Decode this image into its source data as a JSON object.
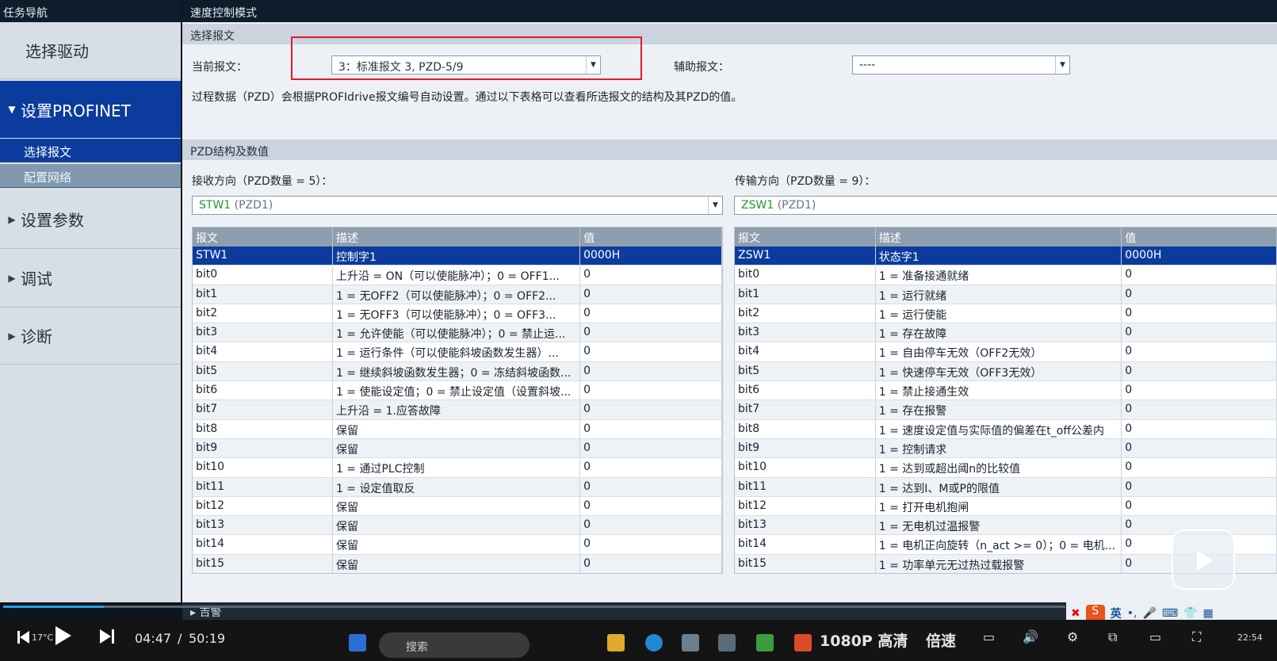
{
  "sidebar": {
    "header": "任务导航",
    "items": [
      {
        "label": "选择驱动",
        "caret": ""
      },
      {
        "label": "设置PROFINET",
        "caret": "▼"
      },
      {
        "label": "设置参数",
        "caret": "▶"
      },
      {
        "label": "调试",
        "caret": "▶"
      },
      {
        "label": "诊断",
        "caret": "▶"
      }
    ],
    "subitems": [
      "选择报文",
      "配置网络"
    ]
  },
  "header": {
    "mode_title": "速度控制模式"
  },
  "select_telegram": {
    "section_title": "选择报文",
    "current_label": "当前报文：",
    "current_value": "3：标准报文 3, PZD-5/9",
    "aux_label": "辅助报文：",
    "aux_value": "----",
    "description": "过程数据（PZD）会根据PROFIdrive报文编号自动设置。通过以下表格可以查看所选报文的结构及其PZD的值。"
  },
  "pzd": {
    "section_title": "PZD结构及数值",
    "receive": {
      "label": "接收方向（PZD数量 = 5）：",
      "select_code": "STW1",
      "select_sub": "(PZD1)",
      "headers": [
        "报文",
        "描述",
        "值"
      ],
      "rows": [
        [
          "STW1",
          "控制字1",
          "0000H"
        ],
        [
          "bit0",
          "上升沿 = ON（可以使能脉冲）；0 = OFF1...",
          "0"
        ],
        [
          "bit1",
          "1 = 无OFF2（可以使能脉冲）；0 = OFF2...",
          "0"
        ],
        [
          "bit2",
          "1 = 无OFF3（可以使能脉冲）；0 = OFF3...",
          "0"
        ],
        [
          "bit3",
          "1 = 允许使能（可以使能脉冲）；0 = 禁止运...",
          "0"
        ],
        [
          "bit4",
          "1 = 运行条件（可以使能斜坡函数发生器）...",
          "0"
        ],
        [
          "bit5",
          "1 = 继续斜坡函数发生器；0 = 冻结斜坡函数...",
          "0"
        ],
        [
          "bit6",
          "1 = 使能设定值；0 = 禁止设定值（设置斜坡...",
          "0"
        ],
        [
          "bit7",
          "上升沿 = 1.应答故障",
          "0"
        ],
        [
          "bit8",
          "保留",
          "0"
        ],
        [
          "bit9",
          "保留",
          "0"
        ],
        [
          "bit10",
          "1 = 通过PLC控制",
          "0"
        ],
        [
          "bit11",
          "1 = 设定值取反",
          "0"
        ],
        [
          "bit12",
          "保留",
          "0"
        ],
        [
          "bit13",
          "保留",
          "0"
        ],
        [
          "bit14",
          "保留",
          "0"
        ],
        [
          "bit15",
          "保留",
          "0"
        ]
      ]
    },
    "transmit": {
      "label": "传输方向（PZD数量 = 9）：",
      "select_code": "ZSW1",
      "select_sub": "(PZD1)",
      "headers": [
        "报文",
        "描述",
        "值"
      ],
      "rows": [
        [
          "ZSW1",
          "状态字1",
          "0000H"
        ],
        [
          "bit0",
          "1 = 准备接通就绪",
          "0"
        ],
        [
          "bit1",
          "1 = 运行就绪",
          "0"
        ],
        [
          "bit2",
          "1 = 运行使能",
          "0"
        ],
        [
          "bit3",
          "1 = 存在故障",
          "0"
        ],
        [
          "bit4",
          "1 = 自由停车无效（OFF2无效）",
          "0"
        ],
        [
          "bit5",
          "1 = 快速停车无效（OFF3无效）",
          "0"
        ],
        [
          "bit6",
          "1 = 禁止接通生效",
          "0"
        ],
        [
          "bit7",
          "1 = 存在报警",
          "0"
        ],
        [
          "bit8",
          "1 = 速度设定值与实际值的偏差在t_off公差内",
          "0"
        ],
        [
          "bit9",
          "1 = 控制请求",
          "0"
        ],
        [
          "bit10",
          "1 = 达到或超出阈n的比较值",
          "0"
        ],
        [
          "bit11",
          "1 = 达到I、M或P的限值",
          "0"
        ],
        [
          "bit12",
          "1 = 打开电机抱闸",
          "0"
        ],
        [
          "bit13",
          "1 = 无电机过温报警",
          "0"
        ],
        [
          "bit14",
          "1 = 电机正向旋转（n_act >= 0）；0 = 电机...",
          "0"
        ],
        [
          "bit15",
          "1 = 功率单元无过热过载报警",
          "0"
        ]
      ]
    }
  },
  "alarm_bar": {
    "label": "吉警"
  },
  "ime": {
    "lang": "英"
  },
  "video": {
    "current_time": "04:47",
    "separator": "/",
    "total_time": "50:19",
    "temperature": "17°C",
    "search_placeholder": "搜索",
    "quality": "1080P 高清",
    "speed": "倍速",
    "clock": "22:54",
    "progress_fraction": 0.0951
  }
}
